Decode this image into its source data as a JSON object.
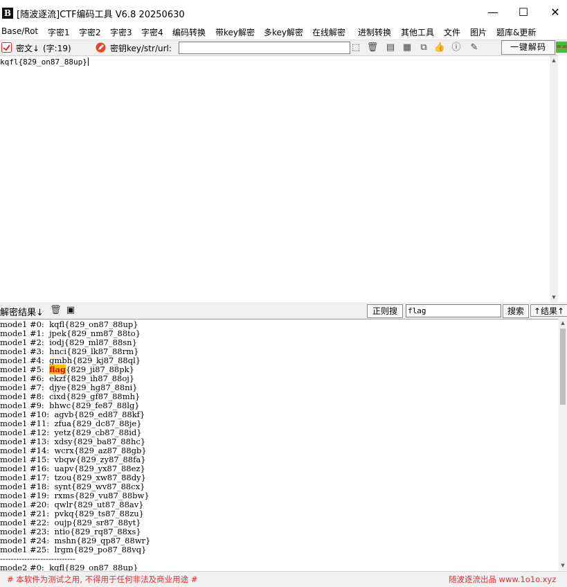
{
  "window": {
    "title": "[随波逐流]CTF编码工具 V6.8  20250630",
    "logo_text": "B",
    "minimize": "—",
    "maximize": "☐",
    "close": "✕"
  },
  "menu": [
    "Base/Rot",
    "字密1",
    "字密2",
    "字密3",
    "字密4",
    "编码转换",
    "带key解密",
    "多key解密",
    "在线解密",
    "进制转换",
    "其他工具",
    "文件",
    "图片",
    "题库&更新"
  ],
  "toolbar": {
    "cipher_label": "密文↓",
    "char_count": "(字:19)",
    "key_label": "密钥key/str/url:",
    "key_value": "",
    "decode_button": "一键解码",
    "edge_label": "=="
  },
  "input": {
    "text": "kqfl{829_on87_88up}"
  },
  "result_bar": {
    "label": "解密结果↓",
    "regex_button": "正则搜",
    "search_value": "flag",
    "search_button": "搜索",
    "results_button": "↑结果↑"
  },
  "output": {
    "lines": [
      {
        "prefix": "mode1 #0:  ",
        "key": "kqfl",
        "rest": "{829_on87_88up}"
      },
      {
        "prefix": "mode1 #1:  ",
        "key": "jpek",
        "rest": "{829_nm87_88to}"
      },
      {
        "prefix": "mode1 #2:  ",
        "key": "iodj",
        "rest": "{829_ml87_88sn}"
      },
      {
        "prefix": "mode1 #3:  ",
        "key": "hnci",
        "rest": "{829_lk87_88rm}"
      },
      {
        "prefix": "mode1 #4:  ",
        "key": "gmbh",
        "rest": "{829_kj87_88ql}"
      },
      {
        "prefix": "mode1 #5:  ",
        "key": "flag",
        "rest": "{829_ji87_88pk}",
        "highlight": true
      },
      {
        "prefix": "mode1 #6:  ",
        "key": "ekzf",
        "rest": "{829_ih87_88oj}"
      },
      {
        "prefix": "mode1 #7:  ",
        "key": "djye",
        "rest": "{829_hg87_88ni}"
      },
      {
        "prefix": "mode1 #8:  ",
        "key": "cixd",
        "rest": "{829_gf87_88mh}"
      },
      {
        "prefix": "mode1 #9:  ",
        "key": "bhwc",
        "rest": "{829_fe87_88lg}"
      },
      {
        "prefix": "mode1 #10:  ",
        "key": "agvb",
        "rest": "{829_ed87_88kf}"
      },
      {
        "prefix": "mode1 #11:  ",
        "key": "zfua",
        "rest": "{829_dc87_88je}"
      },
      {
        "prefix": "mode1 #12:  ",
        "key": "yetz",
        "rest": "{829_cb87_88id}"
      },
      {
        "prefix": "mode1 #13:  ",
        "key": "xdsy",
        "rest": "{829_ba87_88hc}"
      },
      {
        "prefix": "mode1 #14:  ",
        "key": "wcrx",
        "rest": "{829_az87_88gb}"
      },
      {
        "prefix": "mode1 #15:  ",
        "key": "vbqw",
        "rest": "{829_zy87_88fa}"
      },
      {
        "prefix": "mode1 #16:  ",
        "key": "uapv",
        "rest": "{829_yx87_88ez}"
      },
      {
        "prefix": "mode1 #17:  ",
        "key": "tzou",
        "rest": "{829_xw87_88dy}"
      },
      {
        "prefix": "mode1 #18:  ",
        "key": "synt",
        "rest": "{829_wv87_88cx}"
      },
      {
        "prefix": "mode1 #19:  ",
        "key": "rxms",
        "rest": "{829_vu87_88bw}"
      },
      {
        "prefix": "mode1 #20:  ",
        "key": "qwlr",
        "rest": "{829_ut87_88av}"
      },
      {
        "prefix": "mode1 #21:  ",
        "key": "pvkq",
        "rest": "{829_ts87_88zu}"
      },
      {
        "prefix": "mode1 #22:  ",
        "key": "oujp",
        "rest": "{829_sr87_88yt}"
      },
      {
        "prefix": "mode1 #23:  ",
        "key": "ntio",
        "rest": "{829_rq87_88xs}"
      },
      {
        "prefix": "mode1 #24:  ",
        "key": "mshn",
        "rest": "{829_qp87_88wr}"
      },
      {
        "prefix": "mode1 #25:  ",
        "key": "lrgm",
        "rest": "{829_po87_88vq}"
      },
      {
        "prefix": "----------------------------",
        "key": "",
        "rest": ""
      },
      {
        "prefix": "mode2 #0:  ",
        "key": "kqfl",
        "rest": "{829_on87_88up}"
      }
    ]
  },
  "footer": {
    "left": "# 本软件为测试之用, 不得用于任何非法及商业用途 #",
    "right": "随波逐流出品 www.1o1o.xyz"
  },
  "colors": {
    "highlight_bg": "#ffc000",
    "highlight_fg": "#e00000",
    "footer_text": "#e03030"
  }
}
